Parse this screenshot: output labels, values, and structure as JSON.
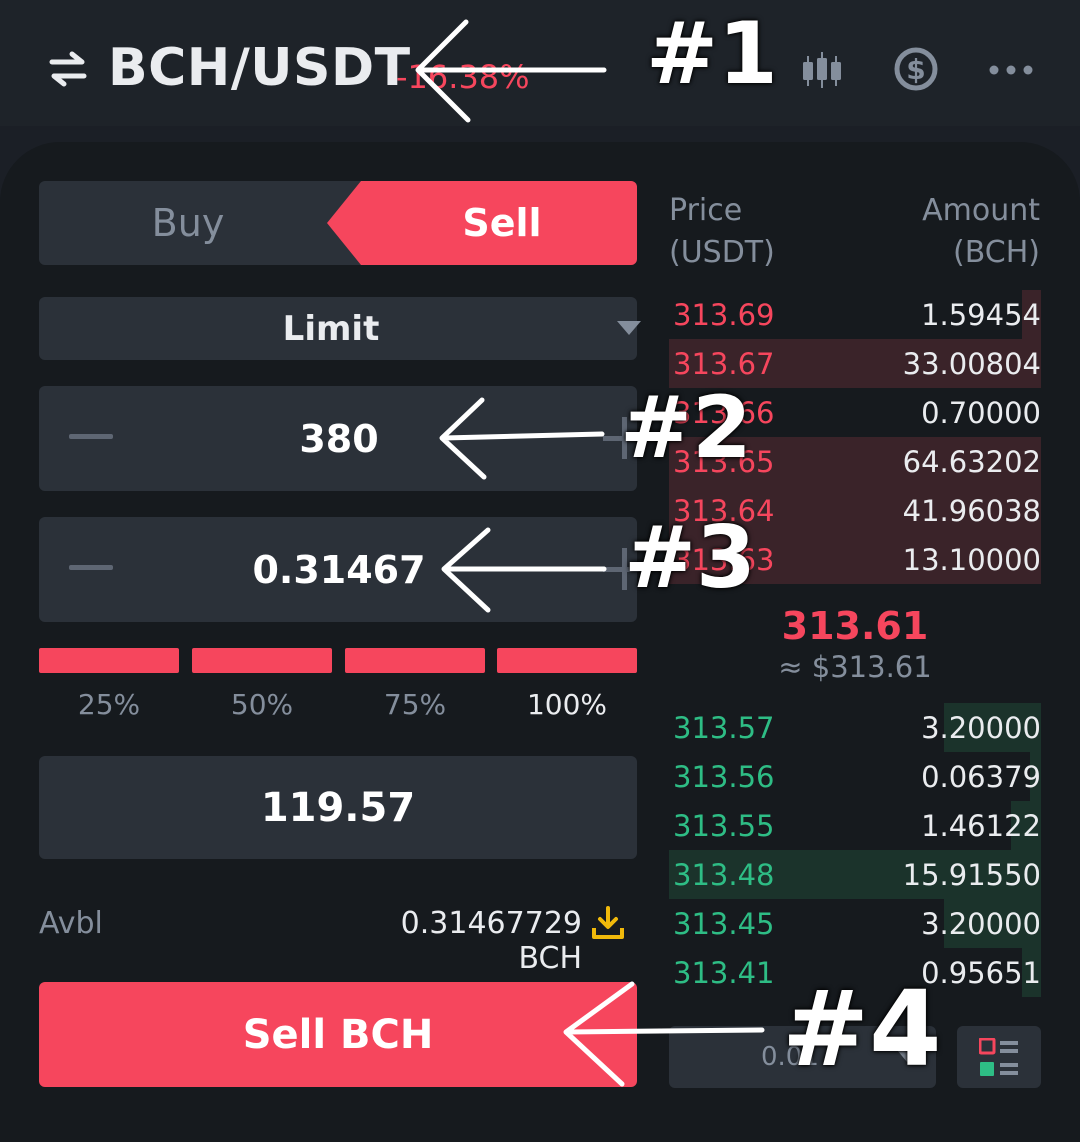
{
  "header": {
    "pair": "BCH/USDT",
    "change": "-16.38%",
    "icons": [
      "swap-icon",
      "candlestick-chart-icon",
      "dollar-icon",
      "more-icon"
    ]
  },
  "order_form": {
    "tabs": {
      "buy": "Buy",
      "sell": "Sell",
      "active": "Sell"
    },
    "order_type": "Limit",
    "price_value": "380",
    "amount_value": "0.31467",
    "percent_options": [
      "25%",
      "50%",
      "75%",
      "100%"
    ],
    "percent_selected": "100%",
    "total_value": "119.57",
    "available_label": "Avbl",
    "available_value": "0.31467729 BCH",
    "submit_label": "Sell BCH"
  },
  "order_book": {
    "price_header_line1": "Price",
    "price_header_line2": "(USDT)",
    "amount_header_line1": "Amount",
    "amount_header_line2": "(BCH)",
    "asks": [
      {
        "price": "313.69",
        "amount": "1.59454",
        "depth": 0.05
      },
      {
        "price": "313.67",
        "amount": "33.00804",
        "depth": 1.0
      },
      {
        "price": "313.66",
        "amount": "0.70000",
        "depth": 0.0
      },
      {
        "price": "313.65",
        "amount": "64.63202",
        "depth": 1.0
      },
      {
        "price": "313.64",
        "amount": "41.96038",
        "depth": 1.0
      },
      {
        "price": "313.63",
        "amount": "13.10000",
        "depth": 1.0
      }
    ],
    "mid_price": "313.61",
    "mid_price_usd": "≈ $313.61",
    "bids": [
      {
        "price": "313.57",
        "amount": "3.20000",
        "depth": 0.26
      },
      {
        "price": "313.56",
        "amount": "0.06379",
        "depth": 0.03
      },
      {
        "price": "313.55",
        "amount": "1.46122",
        "depth": 0.08
      },
      {
        "price": "313.48",
        "amount": "15.91550",
        "depth": 1.0
      },
      {
        "price": "313.45",
        "amount": "3.20000",
        "depth": 0.26
      },
      {
        "price": "313.41",
        "amount": "0.95651",
        "depth": 0.05
      }
    ],
    "precision_value": "0.01"
  },
  "annotations": {
    "label_1": "#1",
    "label_2": "#2",
    "label_3": "#3",
    "label_4": "#4"
  },
  "colors": {
    "sell": "#f6465d",
    "buy": "#2ebd85",
    "background": "#161a1e",
    "surface": "#2b3139",
    "muted_text": "#848e9c",
    "available_icon": "#f0b90b"
  }
}
